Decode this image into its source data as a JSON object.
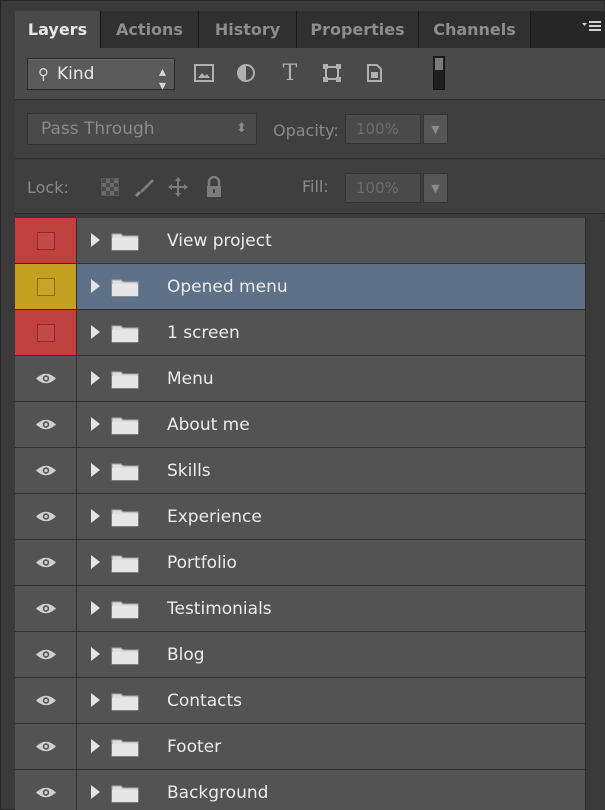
{
  "tabs": [
    {
      "label": "Layers",
      "active": true
    },
    {
      "label": "Actions",
      "active": false
    },
    {
      "label": "History",
      "active": false
    },
    {
      "label": "Properties",
      "active": false
    },
    {
      "label": "Channels",
      "active": false
    }
  ],
  "filter": {
    "kind_label": "Kind",
    "icons": [
      "image-filter-icon",
      "adjustment-filter-icon",
      "type-filter-icon",
      "shape-filter-icon",
      "smart-object-filter-icon"
    ]
  },
  "blend": {
    "mode": "Pass Through",
    "opacity_label": "Opacity:",
    "opacity_value": "100%"
  },
  "lock": {
    "label": "Lock:",
    "fill_label": "Fill:",
    "fill_value": "100%"
  },
  "layers": [
    {
      "name": "View project",
      "visibility": "red"
    },
    {
      "name": "Opened menu",
      "visibility": "yellow",
      "selected": true
    },
    {
      "name": "1 screen",
      "visibility": "red"
    },
    {
      "name": "Menu",
      "visibility": "eye"
    },
    {
      "name": "About me",
      "visibility": "eye"
    },
    {
      "name": "Skills",
      "visibility": "eye"
    },
    {
      "name": "Experience",
      "visibility": "eye"
    },
    {
      "name": "Portfolio",
      "visibility": "eye"
    },
    {
      "name": "Testimonials",
      "visibility": "eye"
    },
    {
      "name": "Blog",
      "visibility": "eye"
    },
    {
      "name": "Contacts",
      "visibility": "eye"
    },
    {
      "name": "Footer",
      "visibility": "eye"
    },
    {
      "name": "Background",
      "visibility": "eye"
    }
  ],
  "colors": {
    "selected_row": "#5e7187",
    "red_label": "#c0403f",
    "yellow_label": "#c4a020"
  }
}
